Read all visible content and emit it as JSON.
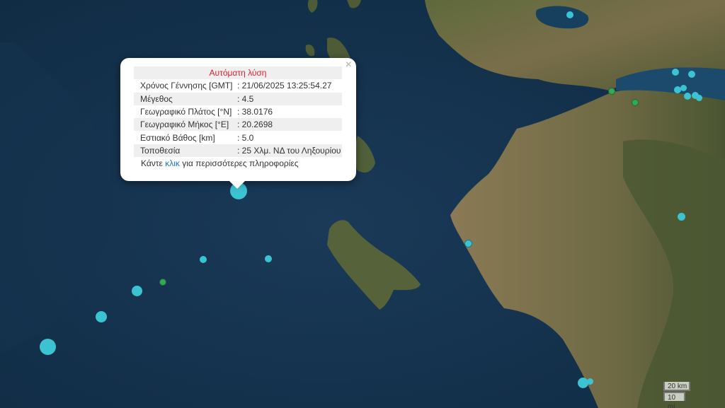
{
  "popup": {
    "title": "Αυτόματη λύση",
    "close_symbol": "×",
    "rows": [
      {
        "label": "Χρόνος Γέννησης [GMT]",
        "value": ": 21/06/2025 13:25:54.27"
      },
      {
        "label": "Μέγεθος",
        "value": ": 4.5"
      },
      {
        "label": "Γεωγραφικό Πλάτος [°N]",
        "value": ": 38.0176"
      },
      {
        "label": "Γεωγραφικό Μήκος [°E]",
        "value": ": 20.2698"
      },
      {
        "label": "Εστιακό Βάθος [km]",
        "value": ": 5.0"
      },
      {
        "label": "Τοποθεσία",
        "value": ": 25 Χλμ. ΝΔ του Ληξουρίου"
      }
    ],
    "more_prefix": "Κάντε ",
    "more_link": "κλικ",
    "more_suffix": " για περισσότερες πληροφορίες"
  },
  "scale": {
    "km_label": "20 km",
    "mi_label": "10 mi"
  },
  "colors": {
    "quake_cyan": "#3cc3d2",
    "quake_green": "#35a857",
    "sea": "#13304a",
    "land": "#6b6a45"
  }
}
